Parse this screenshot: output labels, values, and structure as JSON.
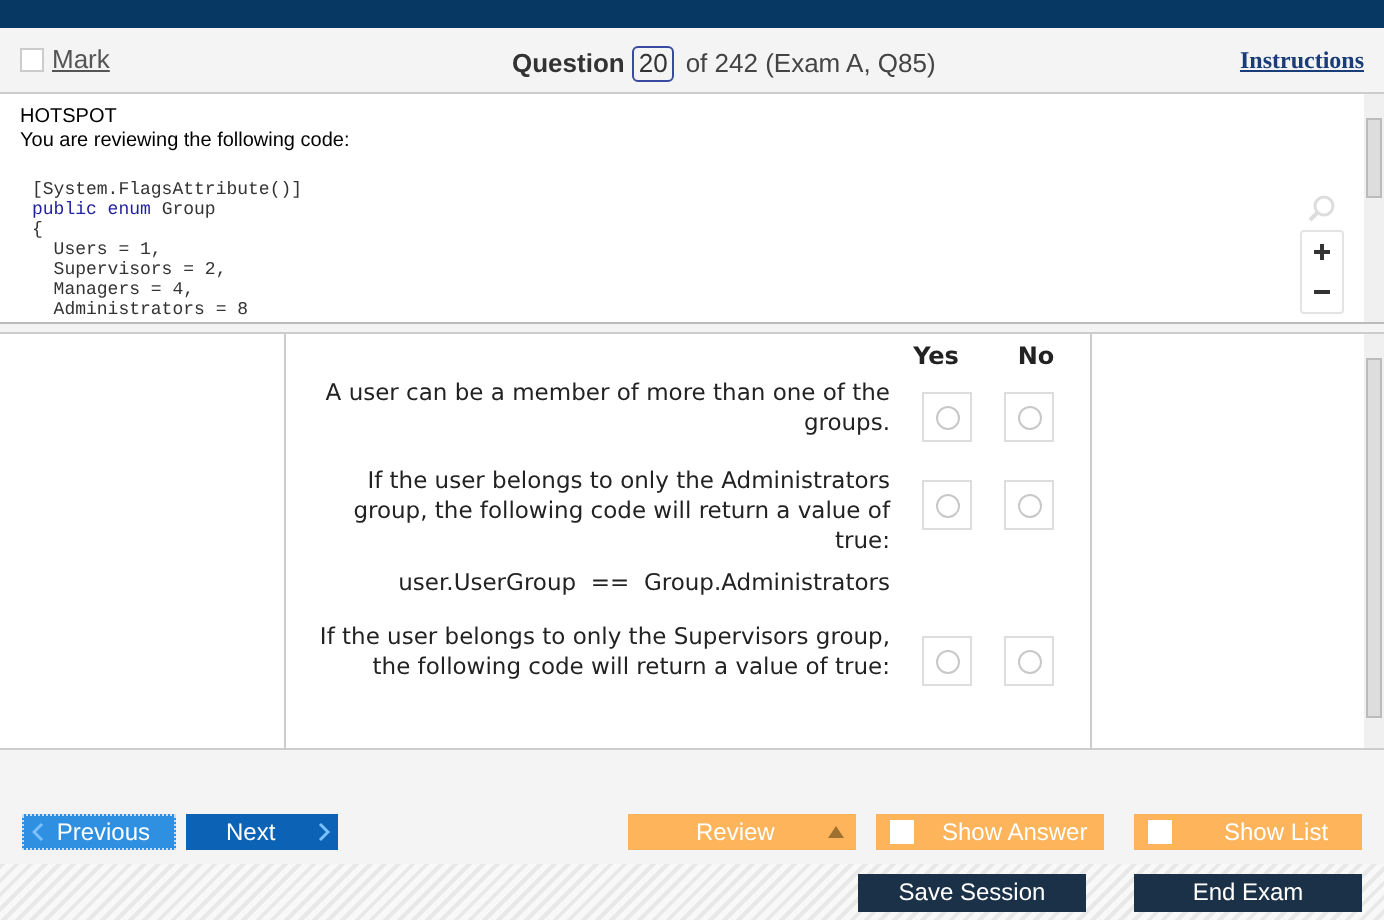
{
  "header": {
    "mark": {
      "label": "Mark",
      "checked": false
    },
    "question_label": "Question",
    "question_number": "20",
    "question_of": "of 242 (Exam A, Q85)",
    "instructions": "Instructions"
  },
  "question": {
    "type": "HOTSPOT",
    "intro": "You are reviewing the following code:",
    "code": [
      [
        {
          "kind": "plain",
          "text": "[System.FlagsAttribute()]"
        }
      ],
      [
        {
          "kind": "keyword",
          "text": "public enum"
        },
        {
          "kind": "plain",
          "text": " Group"
        }
      ],
      [
        {
          "kind": "plain",
          "text": "{"
        }
      ],
      [
        {
          "kind": "plain",
          "text": "  Users = 1,"
        }
      ],
      [
        {
          "kind": "plain",
          "text": "  Supervisors = 2,"
        }
      ],
      [
        {
          "kind": "plain",
          "text": "  Managers = 4,"
        }
      ],
      [
        {
          "kind": "plain",
          "text": "  Administrators = 8"
        }
      ]
    ]
  },
  "answer": {
    "columns": [
      "Yes",
      "No"
    ],
    "statements": [
      {
        "text": "A user can be a member of more than one of the groups.",
        "yes": {
          "selected": false
        },
        "no": {
          "selected": false
        }
      },
      {
        "text": "If the user belongs to only the Administrators group, the following code will return a value of true:",
        "code": "user.UserGroup  ==  Group.Administrators",
        "yes": {
          "selected": false
        },
        "no": {
          "selected": false
        }
      },
      {
        "text": "If the user belongs to only the Supervisors group, the following code will return a value of true:",
        "yes": {
          "selected": false
        },
        "no": {
          "selected": false
        }
      }
    ]
  },
  "nav": {
    "previous": "Previous",
    "next": "Next",
    "review": "Review",
    "show_answer": {
      "label": "Show Answer",
      "checked": false
    },
    "show_list": {
      "label": "Show List",
      "checked": false
    }
  },
  "footer": {
    "save": "Save Session",
    "end": "End Exam"
  }
}
